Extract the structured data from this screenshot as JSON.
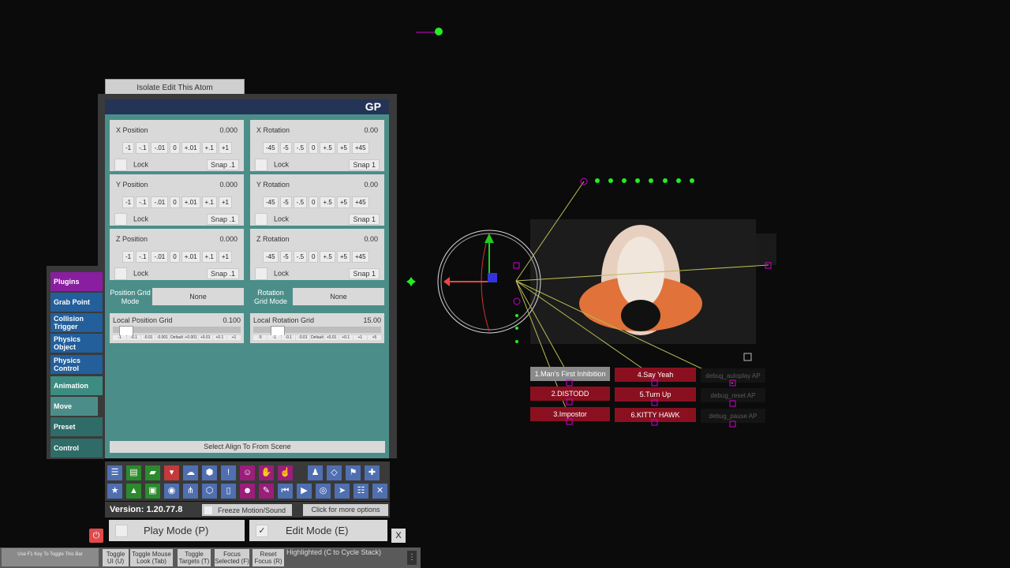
{
  "isolate_button": "Isolate Edit This Atom",
  "panel_title": "GP",
  "position": {
    "x": {
      "label": "X Position",
      "value": "0.000"
    },
    "y": {
      "label": "Y Position",
      "value": "0.000"
    },
    "z": {
      "label": "Z Position",
      "value": "0.000"
    },
    "buttons": [
      "-1",
      "-.1",
      "-.01",
      "0",
      "+.01",
      "+.1",
      "+1"
    ],
    "snap": "Snap .1"
  },
  "rotation": {
    "x": {
      "label": "X Rotation",
      "value": "0.00"
    },
    "y": {
      "label": "Y Rotation",
      "value": "0.00"
    },
    "z": {
      "label": "Z Rotation",
      "value": "0.00"
    },
    "buttons": [
      "-45",
      "-5",
      "-.5",
      "0",
      "+.5",
      "+5",
      "+45"
    ],
    "snap": "Snap 1"
  },
  "lock_label": "Lock",
  "position_grid_mode": {
    "label": "Position Grid Mode",
    "value": "None"
  },
  "rotation_grid_mode": {
    "label": "Rotation Grid Mode",
    "value": "None"
  },
  "local_position_grid": {
    "label": "Local Position Grid",
    "value": "0.100",
    "level": 0.1,
    "ticks": [
      "-1",
      "-0.1",
      "-0.01",
      "-0.001",
      "Default",
      "+0.001",
      "+0.01",
      "+0.1",
      "+1"
    ]
  },
  "local_rotation_grid": {
    "label": "Local Rotation Grid",
    "value": "15.00",
    "level": 0.15,
    "ticks": [
      "-5",
      "-1",
      "-0.1",
      "-0.01",
      "Default",
      "+0.01",
      "+0.1",
      "+1",
      "+5"
    ]
  },
  "select_align": "Select Align To From Scene",
  "tabs": [
    "Plugins",
    "Grab Point",
    "Collision Trigger",
    "Physics Object",
    "Physics Control",
    "Animation",
    "Move",
    "Preset",
    "Control"
  ],
  "toolbar_icons_row1": [
    "menu-icon",
    "open-scene-icon",
    "folder-icon",
    "save-icon",
    "cloud-icon",
    "package-icon",
    "info-icon",
    "add-person-icon",
    "hand-icon",
    "touch-icon",
    "person-icon",
    "unity-icon",
    "flag-icon",
    "plus-icon"
  ],
  "toolbar_icons_row2": [
    "star-icon",
    "landscape-icon",
    "image-icon",
    "camera-icon",
    "nodes-icon",
    "box-icon",
    "document-icon",
    "person-settings-icon",
    "tool-icon",
    "skip-back-icon",
    "play-icon",
    "target-icon",
    "cursor-icon",
    "group-icon",
    "tools-icon"
  ],
  "version": "Version: 1.20.77.8",
  "freeze": "Freeze Motion/Sound",
  "more_options": "Click for more options",
  "play_mode": "Play Mode (P)",
  "edit_mode": "Edit Mode (E)",
  "close": "X",
  "bottom_bar": {
    "f1_hint": "Use F1 Key To Toggle This Bar",
    "buttons": [
      "Toggle UI (U)",
      "Toggle Mouse Look (Tab)",
      "Toggle Targets (T)",
      "Focus Selected (F)",
      "Reset Focus (R)"
    ],
    "highlighted": "Highlighted (C to Cycle Stack)"
  },
  "scene_buttons": [
    {
      "label": "1.Man's First Inhibition",
      "active": true
    },
    {
      "label": "2.DISTODD",
      "active": false
    },
    {
      "label": "3.Impostor",
      "active": false
    },
    {
      "label": "4.Say Yeah",
      "active": false
    },
    {
      "label": "5.Turn Up",
      "active": false
    },
    {
      "label": "6.KITTY HAWK",
      "active": false
    }
  ],
  "debug_buttons": [
    "debug_autoplay AP",
    "debug_reset AP",
    "debug_pause AP"
  ],
  "colors": {
    "panel_teal": "#4b8e89",
    "title_blue": "#243457",
    "plugins_purple": "#8a1ea0",
    "tab_blue": "#225f9b",
    "scene_red": "#8a1020",
    "toolbar_blue": "#4f6fb0",
    "power_red": "#e04a4a"
  }
}
